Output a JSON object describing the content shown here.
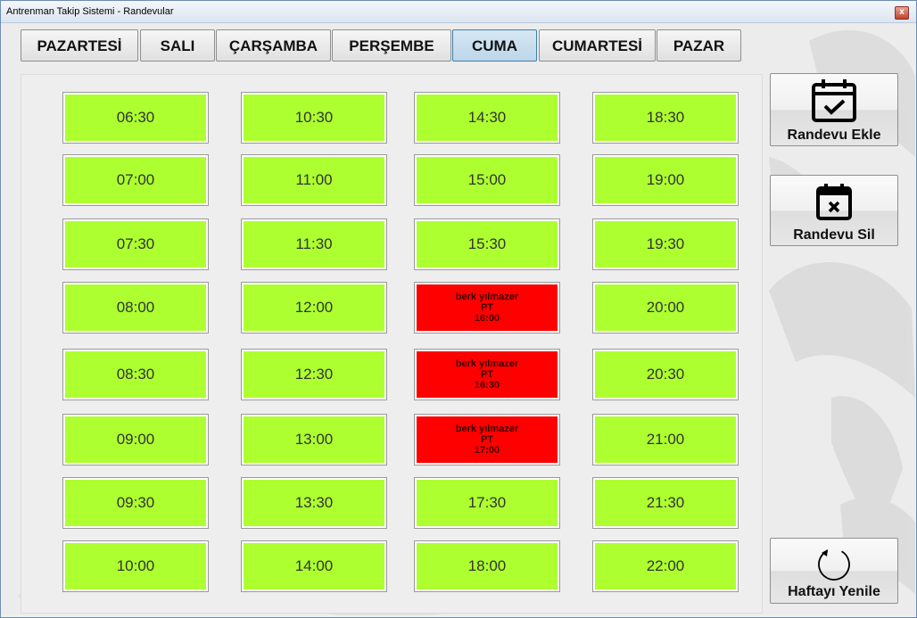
{
  "window": {
    "title": "Antrenman Takip Sistemi - Randevular",
    "close_glyph": "x"
  },
  "tabs": [
    {
      "label": "PAZARTESİ",
      "active": false
    },
    {
      "label": "SALI",
      "active": false
    },
    {
      "label": "ÇARŞAMBA",
      "active": false
    },
    {
      "label": "PERŞEMBE",
      "active": false
    },
    {
      "label": "CUMA",
      "active": true
    },
    {
      "label": "CUMARTESİ",
      "active": false
    },
    {
      "label": "PAZAR",
      "active": false
    }
  ],
  "slots": {
    "col1": [
      {
        "time": "06:30"
      },
      {
        "time": "07:00"
      },
      {
        "time": "07:30"
      },
      {
        "time": "08:00"
      },
      {
        "time": "08:30"
      },
      {
        "time": "09:00"
      },
      {
        "time": "09:30"
      },
      {
        "time": "10:00"
      }
    ],
    "col2": [
      {
        "time": "10:30"
      },
      {
        "time": "11:00"
      },
      {
        "time": "11:30"
      },
      {
        "time": "12:00"
      },
      {
        "time": "12:30"
      },
      {
        "time": "13:00"
      },
      {
        "time": "13:30"
      },
      {
        "time": "14:00"
      }
    ],
    "col3": [
      {
        "time": "14:30"
      },
      {
        "time": "15:00"
      },
      {
        "time": "15:30"
      },
      {
        "time": "16:00",
        "booked": true,
        "name": "berk yılmazer",
        "type": "PT"
      },
      {
        "time": "16:30",
        "booked": true,
        "name": "berk yılmazer",
        "type": "PT"
      },
      {
        "time": "17:00",
        "booked": true,
        "name": "berk yılmazer",
        "type": "PT"
      },
      {
        "time": "17:30"
      },
      {
        "time": "18:00"
      }
    ],
    "col4": [
      {
        "time": "18:30"
      },
      {
        "time": "19:00"
      },
      {
        "time": "19:30"
      },
      {
        "time": "20:00"
      },
      {
        "time": "20:30"
      },
      {
        "time": "21:00"
      },
      {
        "time": "21:30"
      },
      {
        "time": "22:00"
      }
    ]
  },
  "colors": {
    "free_slot": "#adff2f",
    "booked_slot": "#ff0000",
    "active_tab": "#bcd6e9"
  },
  "actions": {
    "add_label": "Randevu Ekle",
    "add_icon": "calendar-check-icon",
    "delete_label": "Randevu Sil",
    "delete_icon": "calendar-x-icon",
    "refresh_label": "Haftayı Yenile",
    "refresh_icon": "refresh-icon"
  }
}
